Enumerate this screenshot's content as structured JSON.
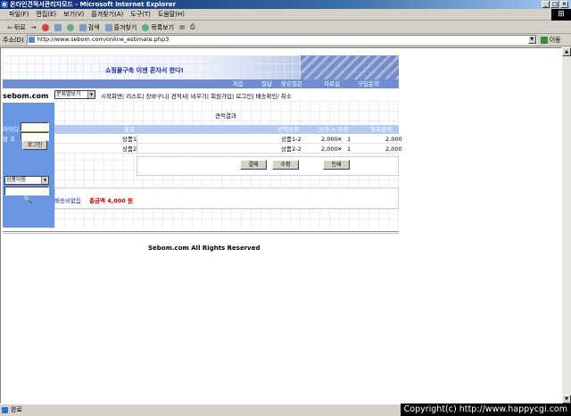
{
  "window": {
    "title": "온라인견적서관리자모드 - Microsoft Internet Explorer",
    "min": "_",
    "max": "□",
    "close": "×"
  },
  "menu": [
    "파일(F)",
    "편집(E)",
    "보기(V)",
    "즐겨찾기(A)",
    "도구(T)",
    "도움말(H)"
  ],
  "toolbar": {
    "back": "뒤로",
    "forward": "→",
    "stop": "⊗",
    "refresh": "↻",
    "home": "⌂",
    "search": "검색",
    "favorites": "즐겨찾기",
    "history": "목록보기",
    "mail": "✉",
    "print": "⎙"
  },
  "address": {
    "label": "주소(D)",
    "url": "http://www.sebom.com/online_estimate.php3",
    "go": "이동"
  },
  "page": {
    "banner_slogan": "쇼핑몰구축 이젠 혼자서 한다!",
    "topnav": [
      "처음",
      "질답",
      "잦은질문",
      "자료실",
      "구입문의"
    ],
    "logo": "sebom.com",
    "login": {
      "id_label": "아이디",
      "pw_label": "암 호",
      "button": "로그인"
    },
    "category_select": "분류별보기",
    "nav_links": [
      "시작화면",
      "리스트",
      "장바구니",
      "견적서",
      "비우기",
      "회원가입",
      "로그인",
      "배송확인",
      "취소"
    ],
    "search": {
      "select": "상품이름",
      "icon": "search-icon"
    },
    "estimate": {
      "title": "견적결과",
      "columns": [
        "항목",
        "선택사항",
        "단가 × 수량",
        "항목합계"
      ],
      "rows": [
        {
          "item": "상품1",
          "option": "상품1-2",
          "price": "2,000",
          "times": "✕",
          "qty": "1",
          "total": "2,000"
        },
        {
          "item": "상품2",
          "option": "상품2-2",
          "price": "2,000",
          "times": "✕",
          "qty": "1",
          "total": "2,000"
        }
      ],
      "buttons": [
        "결제",
        "수정",
        "인쇄"
      ],
      "shipping_note": "배송비없음",
      "total_label": "총금액 4,000 원"
    },
    "footer": "Sebom.com All Rights Reserved"
  },
  "status": {
    "text": "완료"
  },
  "copyright": "Copyright(c) http://www.happycgi.com"
}
